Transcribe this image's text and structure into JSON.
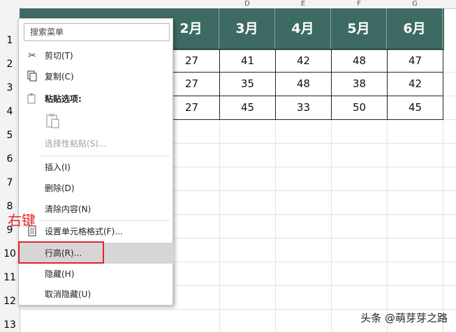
{
  "columns": {
    "letters": [
      "D",
      "E",
      "F",
      "G"
    ]
  },
  "rows": {
    "numbers": [
      "1",
      "2",
      "3",
      "4",
      "5",
      "6",
      "7",
      "8",
      "9",
      "10",
      "11",
      "12",
      "13"
    ]
  },
  "table": {
    "headers": [
      "2月",
      "3月",
      "4月",
      "5月",
      "6月"
    ],
    "rows": [
      [
        "27",
        "41",
        "42",
        "48",
        "47"
      ],
      [
        "27",
        "35",
        "48",
        "38",
        "42"
      ],
      [
        "27",
        "45",
        "33",
        "50",
        "45"
      ]
    ]
  },
  "context_menu": {
    "search_placeholder": "搜索菜单",
    "items": [
      {
        "label": "剪切(T)",
        "icon": "scissors-icon"
      },
      {
        "label": "复制(C)",
        "icon": "copy-icon"
      },
      {
        "label": "粘贴选项:",
        "icon": "paste-options-icon"
      },
      {
        "label": "选择性粘贴(S)...",
        "icon": ""
      },
      {
        "label": "插入(I)",
        "icon": ""
      },
      {
        "label": "删除(D)",
        "icon": ""
      },
      {
        "label": "清除内容(N)",
        "icon": ""
      },
      {
        "label": "设置单元格格式(F)...",
        "icon": "format-cells-icon"
      },
      {
        "label": "行高(R)...",
        "icon": ""
      },
      {
        "label": "隐藏(H)",
        "icon": ""
      },
      {
        "label": "取消隐藏(U)",
        "icon": ""
      }
    ]
  },
  "annotation": "右键",
  "watermark": "头条 @萌芽芽之路",
  "colors": {
    "header_fill": "#3d6b63",
    "highlight": "#d6d6d6",
    "annotation_red": "#e0242b"
  }
}
